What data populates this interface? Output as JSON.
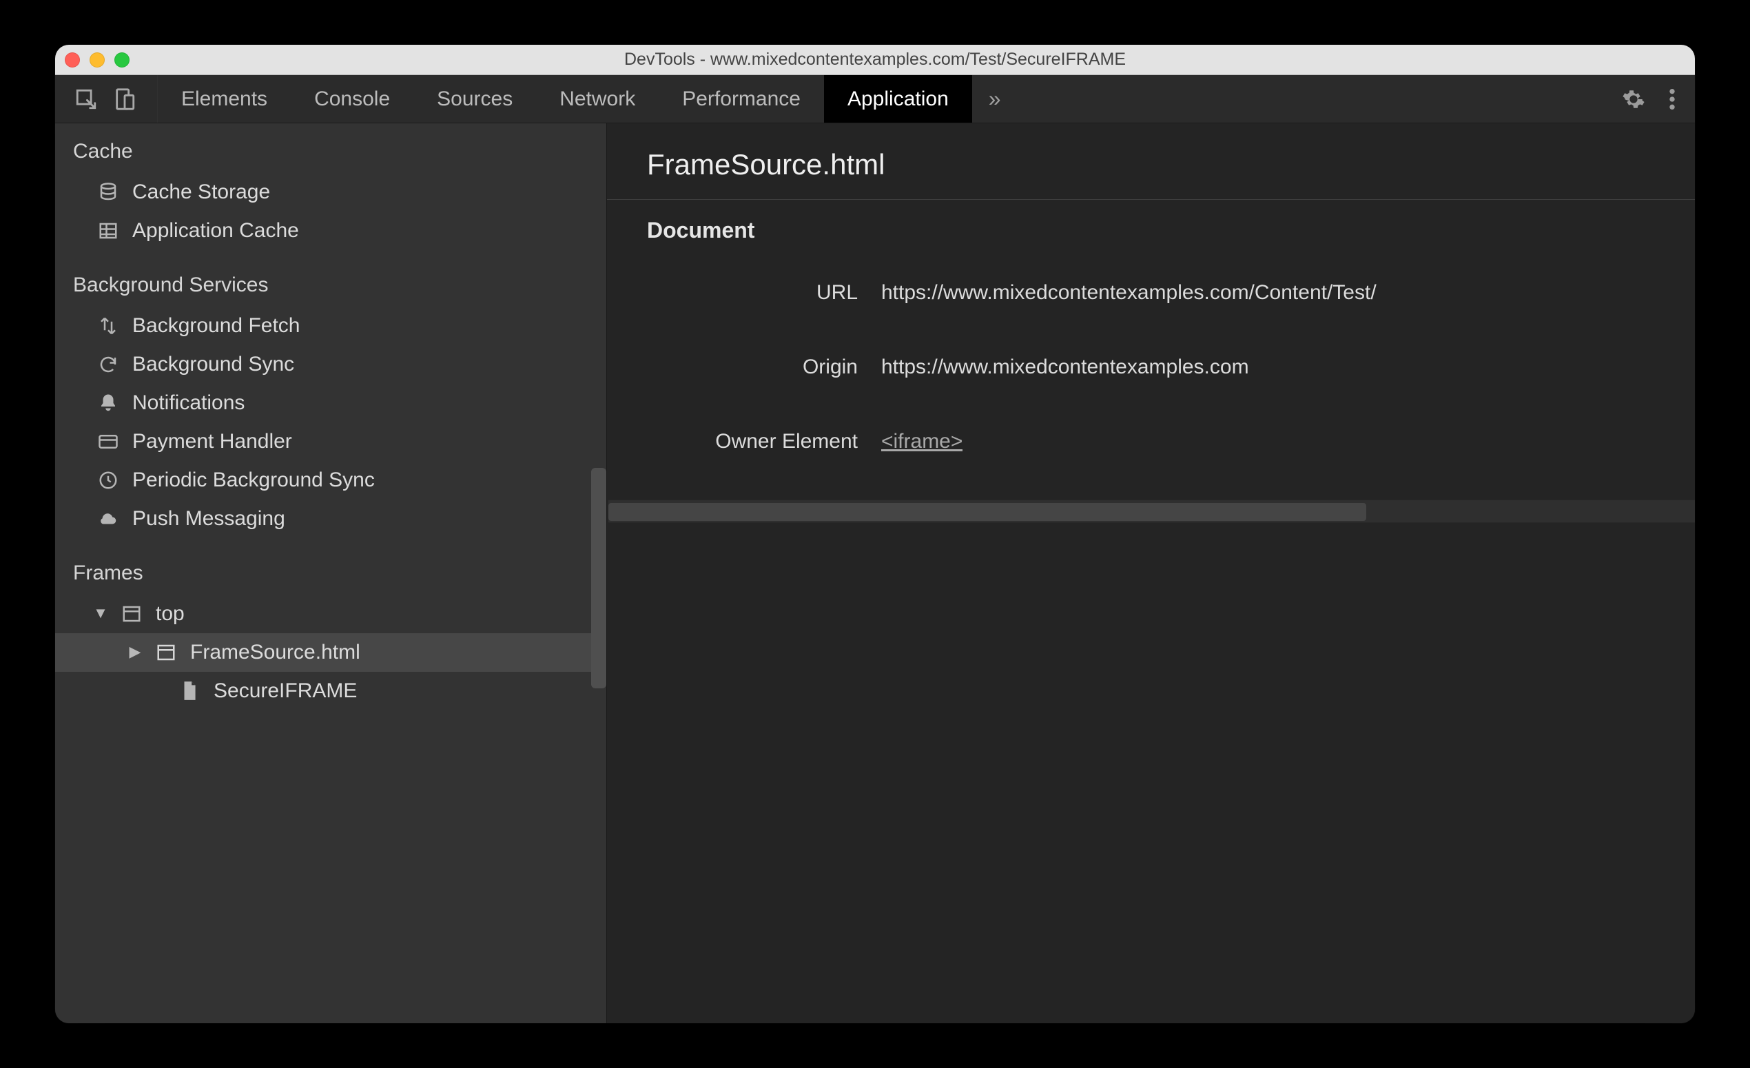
{
  "window": {
    "title": "DevTools - www.mixedcontentexamples.com/Test/SecureIFRAME"
  },
  "toolbar": {
    "tabs": [
      {
        "label": "Elements",
        "active": false
      },
      {
        "label": "Console",
        "active": false
      },
      {
        "label": "Sources",
        "active": false
      },
      {
        "label": "Network",
        "active": false
      },
      {
        "label": "Performance",
        "active": false
      },
      {
        "label": "Application",
        "active": true
      }
    ]
  },
  "sidebar": {
    "sections": {
      "cache": {
        "label": "Cache",
        "items": [
          {
            "label": "Cache Storage",
            "icon": "database"
          },
          {
            "label": "Application Cache",
            "icon": "grid"
          }
        ]
      },
      "background_services": {
        "label": "Background Services",
        "items": [
          {
            "label": "Background Fetch",
            "icon": "swap"
          },
          {
            "label": "Background Sync",
            "icon": "sync"
          },
          {
            "label": "Notifications",
            "icon": "bell"
          },
          {
            "label": "Payment Handler",
            "icon": "card"
          },
          {
            "label": "Periodic Background Sync",
            "icon": "clock"
          },
          {
            "label": "Push Messaging",
            "icon": "cloud"
          }
        ]
      },
      "frames": {
        "label": "Frames",
        "tree": {
          "top": {
            "label": "top",
            "expanded": true
          },
          "frame_source": {
            "label": "FrameSource.html",
            "expanded": false,
            "selected": true
          },
          "secure_iframe": {
            "label": "SecureIFRAME"
          }
        }
      }
    }
  },
  "main": {
    "title": "FrameSource.html",
    "document_section_label": "Document",
    "rows": {
      "url_label": "URL",
      "url_value": "https://www.mixedcontentexamples.com/Content/Test/",
      "origin_label": "Origin",
      "origin_value": "https://www.mixedcontentexamples.com",
      "owner_label": "Owner Element",
      "owner_link_text": "<iframe>"
    }
  }
}
